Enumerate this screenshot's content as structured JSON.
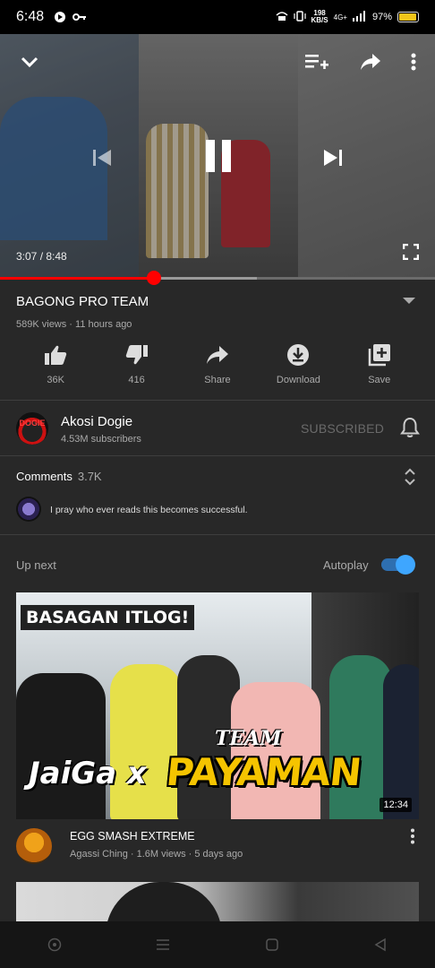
{
  "status_bar": {
    "time": "6:48",
    "speed_value": "198",
    "speed_unit": "KB/S",
    "network": "4G+",
    "battery": "97%",
    "battery_level": 0.97
  },
  "player": {
    "current_time": "3:07",
    "duration": "8:48",
    "time_display": "3:07 / 8:48",
    "progress": 0.354,
    "buffered": 0.59
  },
  "video": {
    "title": "BAGONG PRO TEAM",
    "meta": "589K views · 11 hours ago"
  },
  "actions": [
    {
      "icon": "thumbs-up-icon",
      "label": "36K"
    },
    {
      "icon": "thumbs-down-icon",
      "label": "416"
    },
    {
      "icon": "share-icon",
      "label": "Share"
    },
    {
      "icon": "download-icon",
      "label": "Download"
    },
    {
      "icon": "add-to-playlist-icon",
      "label": "Save"
    }
  ],
  "channel": {
    "avatar_text": "DOGIE",
    "name": "Akosi Dogie",
    "subscribers": "4.53M subscribers",
    "subscribe_state": "SUBSCRIBED"
  },
  "comments": {
    "label": "Comments",
    "count": "3.7K",
    "top_comment": "I pray who ever reads this becomes successful."
  },
  "up_next": {
    "label": "Up next",
    "autoplay_label": "Autoplay",
    "autoplay_on": true,
    "video": {
      "thumb_text_1": "BASAGAN ITLOG!",
      "thumb_text_2": "JaiGa x",
      "thumb_text_3": "TEAM",
      "thumb_text_4": "PAYAMAN",
      "duration": "12:34",
      "title": "EGG SMASH EXTREME",
      "meta": "Agassi Ching · 1.6M views · 5 days ago"
    }
  },
  "colors": {
    "accent_red": "#ff0000",
    "toggle_blue": "#3ea6ff",
    "background": "#282828"
  }
}
